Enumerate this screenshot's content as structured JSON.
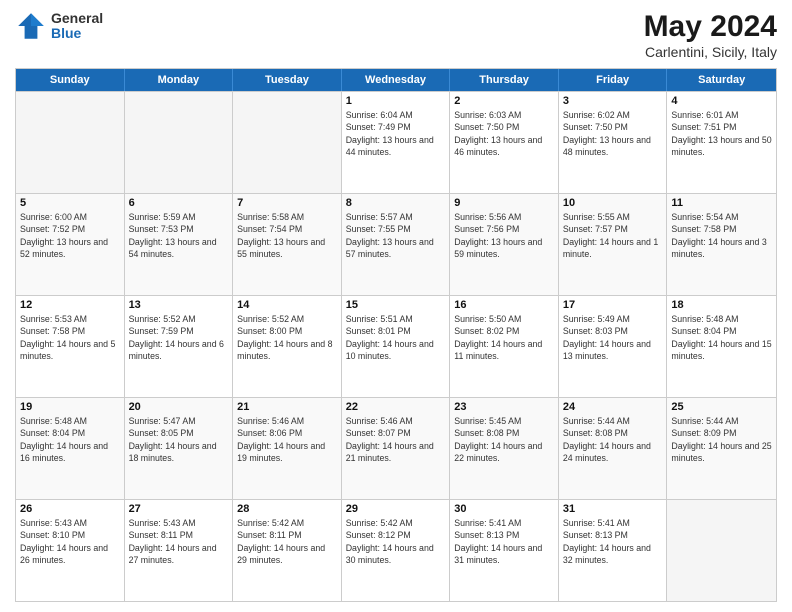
{
  "logo": {
    "general": "General",
    "blue": "Blue"
  },
  "title": "May 2024",
  "subtitle": "Carlentini, Sicily, Italy",
  "header_days": [
    "Sunday",
    "Monday",
    "Tuesday",
    "Wednesday",
    "Thursday",
    "Friday",
    "Saturday"
  ],
  "weeks": [
    [
      {
        "day": "",
        "sunrise": "",
        "sunset": "",
        "daylight": ""
      },
      {
        "day": "",
        "sunrise": "",
        "sunset": "",
        "daylight": ""
      },
      {
        "day": "",
        "sunrise": "",
        "sunset": "",
        "daylight": ""
      },
      {
        "day": "1",
        "sunrise": "Sunrise: 6:04 AM",
        "sunset": "Sunset: 7:49 PM",
        "daylight": "Daylight: 13 hours and 44 minutes."
      },
      {
        "day": "2",
        "sunrise": "Sunrise: 6:03 AM",
        "sunset": "Sunset: 7:50 PM",
        "daylight": "Daylight: 13 hours and 46 minutes."
      },
      {
        "day": "3",
        "sunrise": "Sunrise: 6:02 AM",
        "sunset": "Sunset: 7:50 PM",
        "daylight": "Daylight: 13 hours and 48 minutes."
      },
      {
        "day": "4",
        "sunrise": "Sunrise: 6:01 AM",
        "sunset": "Sunset: 7:51 PM",
        "daylight": "Daylight: 13 hours and 50 minutes."
      }
    ],
    [
      {
        "day": "5",
        "sunrise": "Sunrise: 6:00 AM",
        "sunset": "Sunset: 7:52 PM",
        "daylight": "Daylight: 13 hours and 52 minutes."
      },
      {
        "day": "6",
        "sunrise": "Sunrise: 5:59 AM",
        "sunset": "Sunset: 7:53 PM",
        "daylight": "Daylight: 13 hours and 54 minutes."
      },
      {
        "day": "7",
        "sunrise": "Sunrise: 5:58 AM",
        "sunset": "Sunset: 7:54 PM",
        "daylight": "Daylight: 13 hours and 55 minutes."
      },
      {
        "day": "8",
        "sunrise": "Sunrise: 5:57 AM",
        "sunset": "Sunset: 7:55 PM",
        "daylight": "Daylight: 13 hours and 57 minutes."
      },
      {
        "day": "9",
        "sunrise": "Sunrise: 5:56 AM",
        "sunset": "Sunset: 7:56 PM",
        "daylight": "Daylight: 13 hours and 59 minutes."
      },
      {
        "day": "10",
        "sunrise": "Sunrise: 5:55 AM",
        "sunset": "Sunset: 7:57 PM",
        "daylight": "Daylight: 14 hours and 1 minute."
      },
      {
        "day": "11",
        "sunrise": "Sunrise: 5:54 AM",
        "sunset": "Sunset: 7:58 PM",
        "daylight": "Daylight: 14 hours and 3 minutes."
      }
    ],
    [
      {
        "day": "12",
        "sunrise": "Sunrise: 5:53 AM",
        "sunset": "Sunset: 7:58 PM",
        "daylight": "Daylight: 14 hours and 5 minutes."
      },
      {
        "day": "13",
        "sunrise": "Sunrise: 5:52 AM",
        "sunset": "Sunset: 7:59 PM",
        "daylight": "Daylight: 14 hours and 6 minutes."
      },
      {
        "day": "14",
        "sunrise": "Sunrise: 5:52 AM",
        "sunset": "Sunset: 8:00 PM",
        "daylight": "Daylight: 14 hours and 8 minutes."
      },
      {
        "day": "15",
        "sunrise": "Sunrise: 5:51 AM",
        "sunset": "Sunset: 8:01 PM",
        "daylight": "Daylight: 14 hours and 10 minutes."
      },
      {
        "day": "16",
        "sunrise": "Sunrise: 5:50 AM",
        "sunset": "Sunset: 8:02 PM",
        "daylight": "Daylight: 14 hours and 11 minutes."
      },
      {
        "day": "17",
        "sunrise": "Sunrise: 5:49 AM",
        "sunset": "Sunset: 8:03 PM",
        "daylight": "Daylight: 14 hours and 13 minutes."
      },
      {
        "day": "18",
        "sunrise": "Sunrise: 5:48 AM",
        "sunset": "Sunset: 8:04 PM",
        "daylight": "Daylight: 14 hours and 15 minutes."
      }
    ],
    [
      {
        "day": "19",
        "sunrise": "Sunrise: 5:48 AM",
        "sunset": "Sunset: 8:04 PM",
        "daylight": "Daylight: 14 hours and 16 minutes."
      },
      {
        "day": "20",
        "sunrise": "Sunrise: 5:47 AM",
        "sunset": "Sunset: 8:05 PM",
        "daylight": "Daylight: 14 hours and 18 minutes."
      },
      {
        "day": "21",
        "sunrise": "Sunrise: 5:46 AM",
        "sunset": "Sunset: 8:06 PM",
        "daylight": "Daylight: 14 hours and 19 minutes."
      },
      {
        "day": "22",
        "sunrise": "Sunrise: 5:46 AM",
        "sunset": "Sunset: 8:07 PM",
        "daylight": "Daylight: 14 hours and 21 minutes."
      },
      {
        "day": "23",
        "sunrise": "Sunrise: 5:45 AM",
        "sunset": "Sunset: 8:08 PM",
        "daylight": "Daylight: 14 hours and 22 minutes."
      },
      {
        "day": "24",
        "sunrise": "Sunrise: 5:44 AM",
        "sunset": "Sunset: 8:08 PM",
        "daylight": "Daylight: 14 hours and 24 minutes."
      },
      {
        "day": "25",
        "sunrise": "Sunrise: 5:44 AM",
        "sunset": "Sunset: 8:09 PM",
        "daylight": "Daylight: 14 hours and 25 minutes."
      }
    ],
    [
      {
        "day": "26",
        "sunrise": "Sunrise: 5:43 AM",
        "sunset": "Sunset: 8:10 PM",
        "daylight": "Daylight: 14 hours and 26 minutes."
      },
      {
        "day": "27",
        "sunrise": "Sunrise: 5:43 AM",
        "sunset": "Sunset: 8:11 PM",
        "daylight": "Daylight: 14 hours and 27 minutes."
      },
      {
        "day": "28",
        "sunrise": "Sunrise: 5:42 AM",
        "sunset": "Sunset: 8:11 PM",
        "daylight": "Daylight: 14 hours and 29 minutes."
      },
      {
        "day": "29",
        "sunrise": "Sunrise: 5:42 AM",
        "sunset": "Sunset: 8:12 PM",
        "daylight": "Daylight: 14 hours and 30 minutes."
      },
      {
        "day": "30",
        "sunrise": "Sunrise: 5:41 AM",
        "sunset": "Sunset: 8:13 PM",
        "daylight": "Daylight: 14 hours and 31 minutes."
      },
      {
        "day": "31",
        "sunrise": "Sunrise: 5:41 AM",
        "sunset": "Sunset: 8:13 PM",
        "daylight": "Daylight: 14 hours and 32 minutes."
      },
      {
        "day": "",
        "sunrise": "",
        "sunset": "",
        "daylight": ""
      }
    ]
  ]
}
